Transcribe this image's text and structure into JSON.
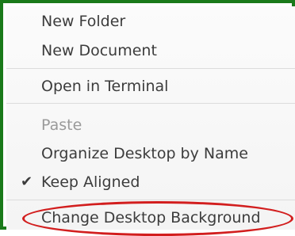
{
  "menu": {
    "items": [
      {
        "label": "New Folder"
      },
      {
        "label": "New Document"
      },
      {
        "label": "Open in Terminal"
      },
      {
        "label": "Paste"
      },
      {
        "label": "Organize Desktop by Name"
      },
      {
        "label": "Keep Aligned",
        "checked": true,
        "check_glyph": "✔"
      },
      {
        "label": "Change Desktop Background"
      }
    ]
  },
  "colors": {
    "frame_border": "#1a7a1a",
    "highlight_oval": "#d21e1e",
    "text": "#3c3c3c",
    "disabled_text": "#9a9a9a"
  }
}
